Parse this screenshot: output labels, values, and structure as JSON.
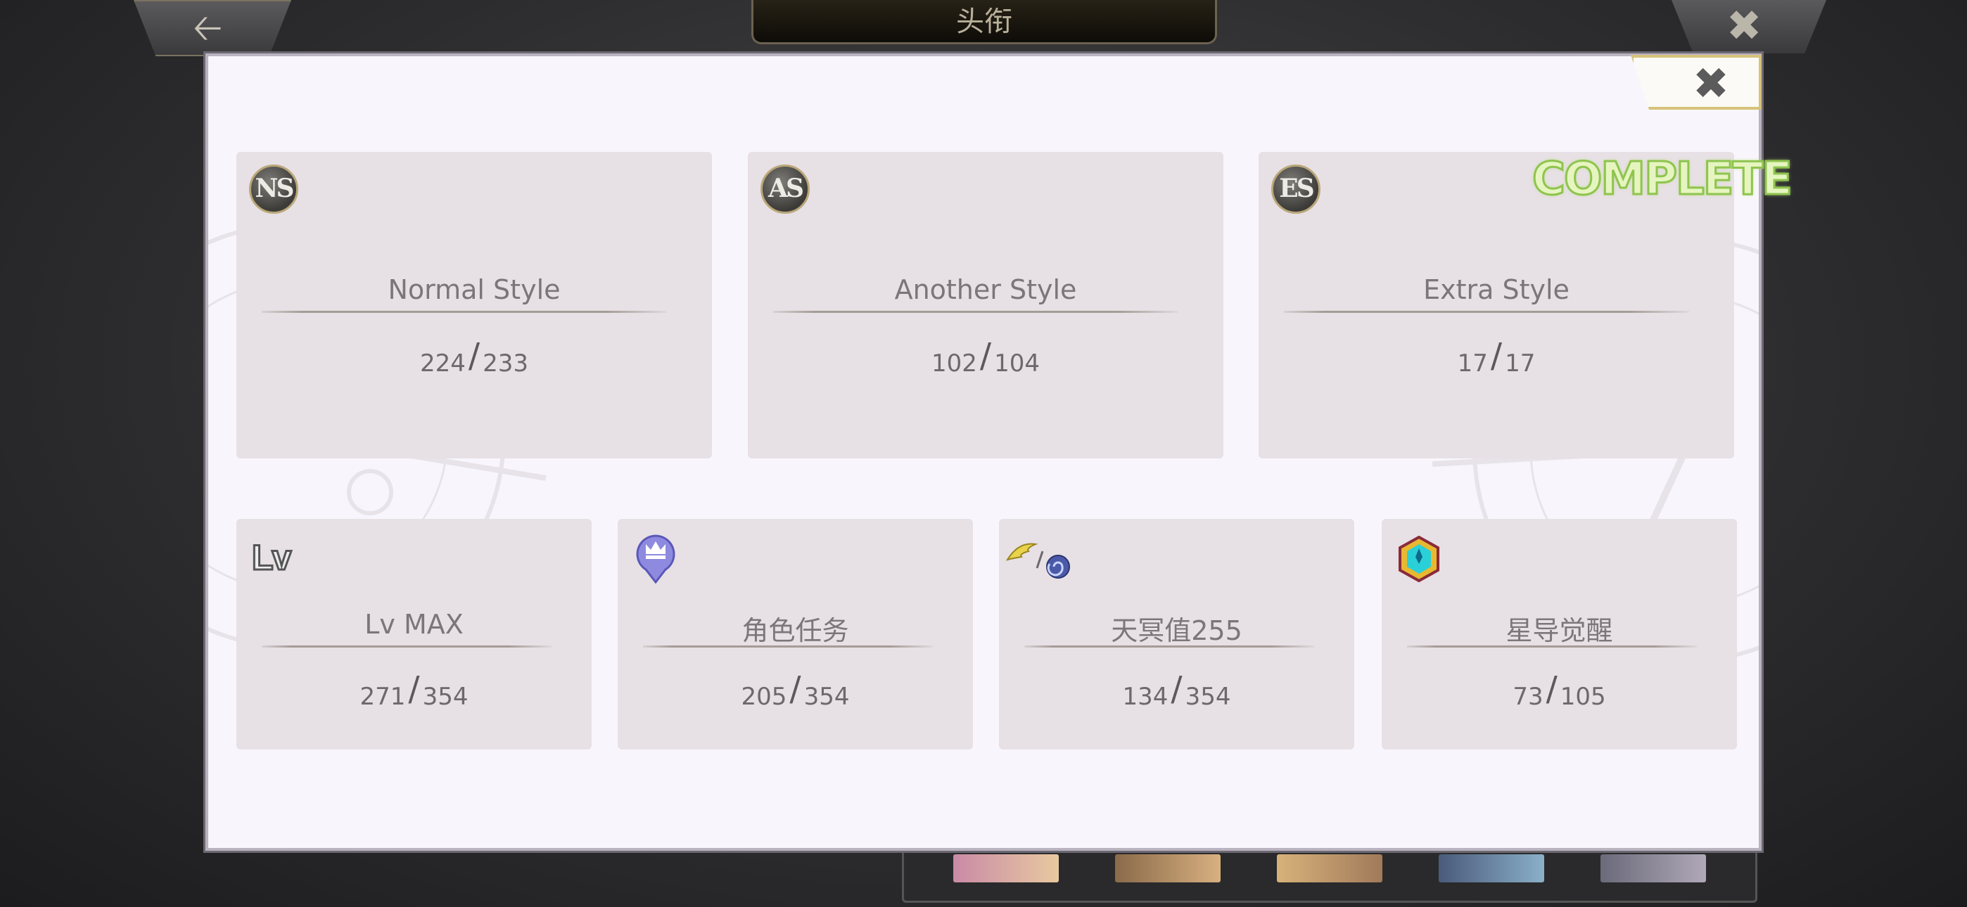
{
  "topbar": {
    "title": "头衔",
    "back_icon": "arrow-left-icon",
    "close_icon": "close-icon"
  },
  "modal": {
    "close_icon": "close-icon",
    "complete_label": "COMPLETE",
    "style_cards": [
      {
        "badge": "NS",
        "label": "Normal Style",
        "current": "224",
        "total": "233"
      },
      {
        "badge": "AS",
        "label": "Another Style",
        "current": "102",
        "total": "104"
      },
      {
        "badge": "ES",
        "label": "Extra Style",
        "current": "17",
        "total": "17"
      }
    ],
    "stat_cards": [
      {
        "icon_text": "Lv",
        "label": "Lv MAX",
        "current": "271",
        "total": "354"
      },
      {
        "icon": "crown-marker-icon",
        "label": "角色任务",
        "current": "205",
        "total": "354"
      },
      {
        "icon": "wing-and-spiral-icon",
        "label": "天冥值255",
        "current": "134",
        "total": "354"
      },
      {
        "icon": "star-crystal-icon",
        "label": "星导觉醒",
        "current": "73",
        "total": "105"
      }
    ]
  },
  "colors": {
    "card_bg": "#e7e0e5",
    "modal_bg": "#f8f6fc",
    "complete_green": "#8fc44f",
    "gold_border": "#d6c27a"
  }
}
